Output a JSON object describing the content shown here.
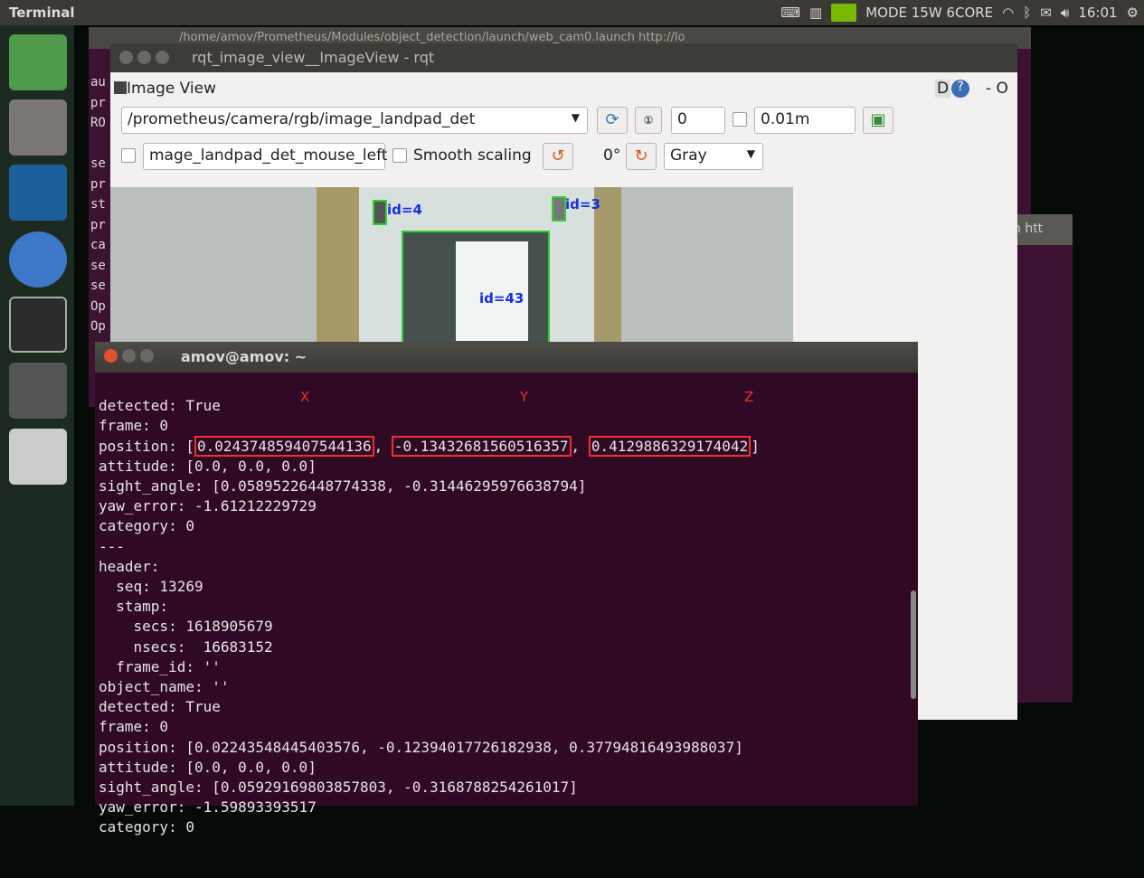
{
  "topbar": {
    "title": "Terminal",
    "power_mode": "MODE 15W 6CORE",
    "time": "16:01",
    "icons": [
      "keyboard-icon",
      "mem-indicator-icon",
      "nvidia-icon",
      "wifi-icon",
      "bluetooth-icon",
      "mail-icon",
      "volume-icon",
      "power-icon"
    ]
  },
  "launcher": {
    "items": [
      "ubuntu-dash",
      "files",
      "vscode",
      "chromium",
      "terminal",
      "workspace",
      "drive"
    ]
  },
  "back_window": {
    "title": "/home/amov/Prometheus/Modules/object_detection/launch/web_cam0.launch http://lo",
    "lines": [
      "au",
      "pr",
      "RO",
      "",
      "se",
      "pr",
      "st",
      "pr",
      "ca",
      "se",
      "se",
      "Op",
      "Op"
    ]
  },
  "right_window": {
    "title": "n htt"
  },
  "rqt": {
    "title": "rqt_image_view__ImageView - rqt",
    "plugin_title": "Image View",
    "d_label": "D",
    "topic": "/prometheus/camera/rgb/image_landpad_det",
    "spin1": "0",
    "spin2": "0.01m",
    "mouse_topic": "mage_landpad_det_mouse_left",
    "smooth_label": "Smooth scaling",
    "rotation": "0°",
    "colormap": "Gray",
    "right_label": "- O",
    "markers": [
      "id=4",
      "id=3",
      "id=43"
    ]
  },
  "terminal": {
    "title": "amov@amov: ~",
    "axis_labels": {
      "x": "X",
      "y": "Y",
      "z": "Z"
    },
    "pos_x": "0.024374859407544136",
    "pos_y": "-0.13432681560516357",
    "pos_z": "0.4129886329174042",
    "lines": [
      "detected: True",
      "frame: 0",
      "",
      "attitude: [0.0, 0.0, 0.0]",
      "sight_angle: [0.05895226448774338, -0.31446295976638794]",
      "yaw_error: -1.61212229729",
      "category: 0",
      "---",
      "header:",
      "  seq: 13269",
      "  stamp:",
      "    secs: 1618905679",
      "    nsecs:  16683152",
      "  frame_id: ''",
      "object_name: ''",
      "detected: True",
      "frame: 0",
      "position: [0.02243548445403576, -0.12394017726182938, 0.37794816493988037]",
      "attitude: [0.0, 0.0, 0.0]",
      "sight_angle: [0.05929169803857803, -0.3168788254261017]",
      "yaw_error: -1.59893393517",
      "category: 0"
    ],
    "position_prefix": "position: ["
  }
}
